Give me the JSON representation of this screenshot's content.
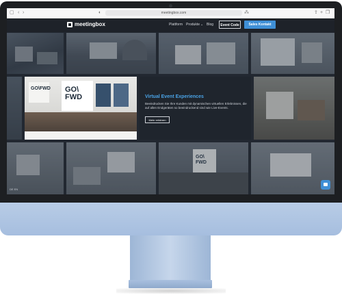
{
  "browser": {
    "url": "meetingbox.com"
  },
  "nav": {
    "logo": "meetingbox",
    "links": [
      "Plattform",
      "Produkte",
      "Blog"
    ],
    "event_code": "Event Code",
    "sales": "Sales Kontakt"
  },
  "feature": {
    "title": "Virtual Event Experiences",
    "text": "Beeindrucken Sie Ihre Kunden mit dynamischen virtuellen Erlebnissen, die auf allen Endgeräten so beeindruckend sind wie Live-Events.",
    "button": "Mehr erfahren"
  },
  "stage_screens": {
    "left": "GO\\FWD",
    "right": "GO\\ FWD"
  },
  "footer": {
    "lang": "DE EN"
  },
  "colors": {
    "accent": "#3f8fd6",
    "accent_text": "#4aa3e6",
    "background": "#222831",
    "device_blue": "#a6bedf"
  }
}
